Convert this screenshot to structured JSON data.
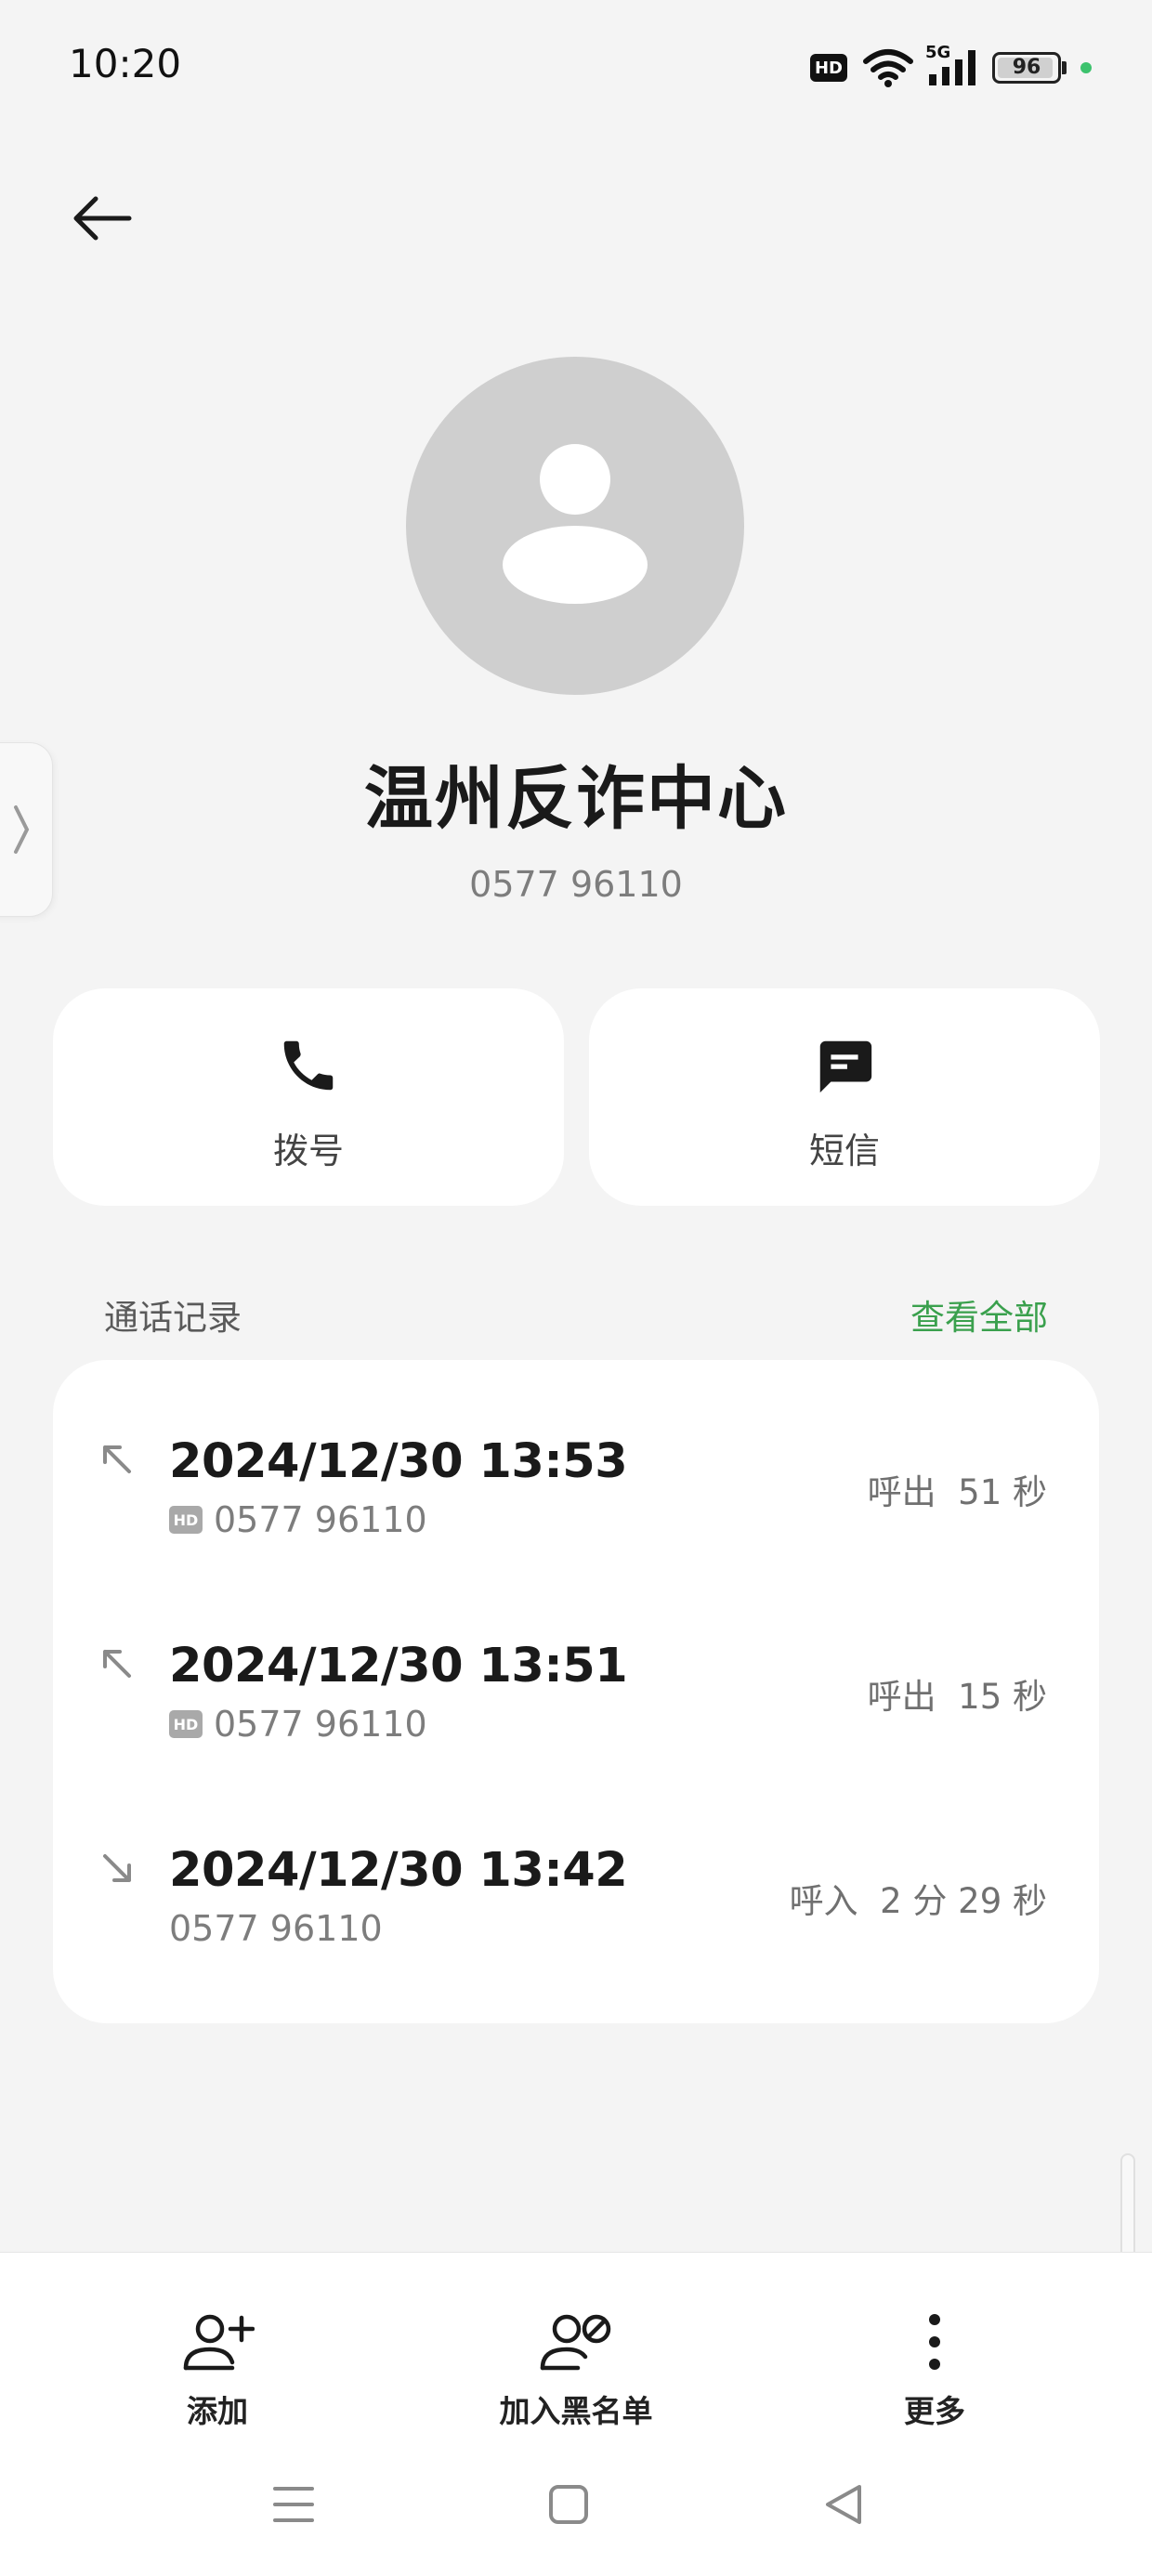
{
  "status_bar": {
    "time": "10:20",
    "hd": "HD",
    "network": "5G",
    "battery_level": "96",
    "battery_fraction": 0.96,
    "privacy_dot_color": "#3cc26d"
  },
  "contact": {
    "name": "温州反诈中心",
    "number": "0577 96110"
  },
  "actions": {
    "call_label": "拨号",
    "sms_label": "短信"
  },
  "history": {
    "heading": "通话记录",
    "view_all": "查看全部",
    "calls": [
      {
        "datetime": "2024/12/30 13:53",
        "hd": "HD",
        "number": "0577 96110",
        "direction": "outgoing",
        "type_label": "呼出",
        "duration": "51 秒"
      },
      {
        "datetime": "2024/12/30 13:51",
        "hd": "HD",
        "number": "0577 96110",
        "direction": "outgoing",
        "type_label": "呼出",
        "duration": "15 秒"
      },
      {
        "datetime": "2024/12/30 13:42",
        "hd": "",
        "number": "0577 96110",
        "direction": "incoming",
        "type_label": "呼入",
        "duration": "2 分 29 秒"
      }
    ]
  },
  "bottom_bar": {
    "add_label": "添加",
    "block_label": "加入黑名单",
    "more_label": "更多"
  },
  "colors": {
    "accent_green": "#3aa04d",
    "background": "#f4f4f4",
    "card": "#ffffff"
  }
}
